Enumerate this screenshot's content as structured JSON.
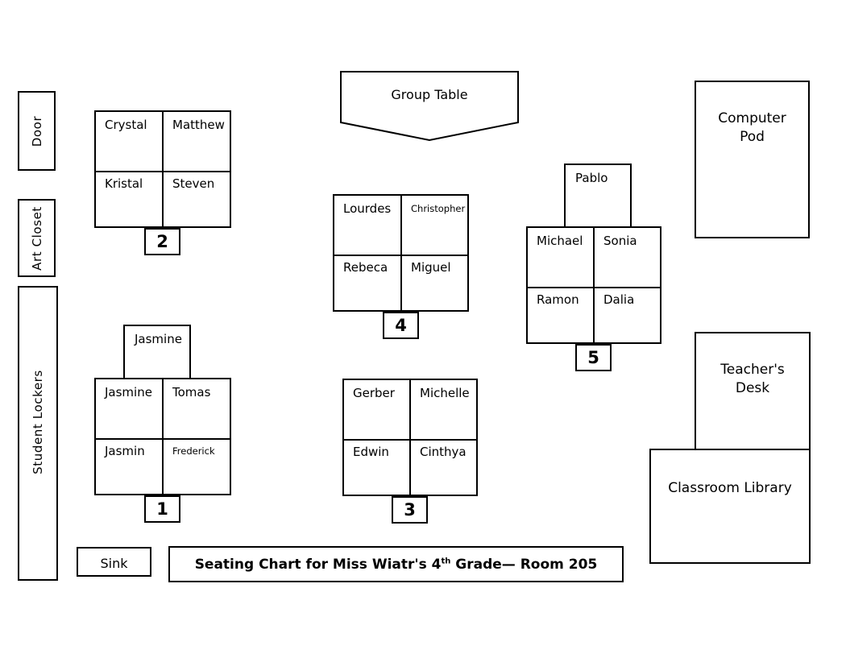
{
  "title": {
    "prefix": "Seating Chart for Miss Wiatr's 4",
    "ordinal": "th",
    "suffix": " Grade— Room 205"
  },
  "facilities": {
    "door": "Door",
    "art_closet": "Art Closet",
    "student_lockers": "Student Lockers",
    "computer_pod": "Computer\nPod",
    "computer_pod_line1": "Computer",
    "computer_pod_line2": "Pod",
    "teachers_desk_line1": "Teacher's",
    "teachers_desk_line2": "Desk",
    "classroom_library": "Classroom Library",
    "group_table": "Group Table",
    "sink": "Sink"
  },
  "groups": [
    {
      "number": "1",
      "front_desk": "Jasmine",
      "seats": [
        [
          "Jasmine",
          "Tomas"
        ],
        [
          "Jasmin",
          "Frederick"
        ]
      ],
      "small_font_seats": [
        "Frederick"
      ]
    },
    {
      "number": "2",
      "front_desk": null,
      "seats": [
        [
          "Crystal",
          "Matthew"
        ],
        [
          "Kristal",
          "Steven"
        ]
      ],
      "small_font_seats": []
    },
    {
      "number": "3",
      "front_desk": null,
      "seats": [
        [
          "Gerber",
          "Michelle"
        ],
        [
          "Edwin",
          "Cinthya"
        ]
      ],
      "small_font_seats": []
    },
    {
      "number": "4",
      "front_desk": null,
      "seats": [
        [
          "Lourdes",
          "Christopher"
        ],
        [
          "Rebeca",
          "Miguel"
        ]
      ],
      "small_font_seats": [
        "Christopher"
      ]
    },
    {
      "number": "5",
      "front_desk": "Pablo",
      "seats": [
        [
          "Michael",
          "Sonia"
        ],
        [
          "Ramon",
          "Dalia"
        ]
      ],
      "small_font_seats": []
    }
  ],
  "colors": {
    "line": "#000000",
    "background": "#ffffff",
    "text": "#000000"
  }
}
